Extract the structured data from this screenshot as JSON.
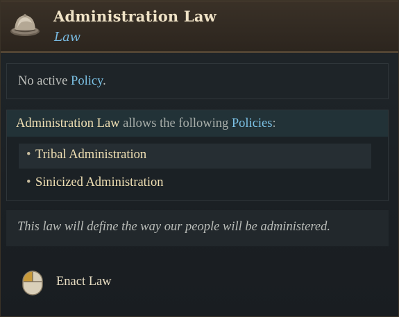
{
  "header": {
    "title": "Administration Law",
    "subtitle": "Law",
    "icon": "pith-helmet-icon"
  },
  "policy_status": {
    "prefix": "No active",
    "link": "Policy",
    "suffix": "."
  },
  "allows": {
    "law_name": "Administration Law",
    "middle": "allows the following",
    "link": "Policies",
    "suffix": ":",
    "policies": [
      {
        "bullet": "•",
        "name": "Tribal Administration"
      },
      {
        "bullet": "•",
        "name": "Sinicized Administration"
      }
    ]
  },
  "description": "This law will define the way our people will be administered.",
  "action": {
    "label": "Enact Law",
    "icon": "left-mouse-button-icon"
  },
  "colors": {
    "header_bg": "#332b22",
    "title": "#efe2c6",
    "link_blue": "#7cc2e6",
    "policy_gold": "#f0e0b4",
    "body_bg": "#1c2125"
  }
}
